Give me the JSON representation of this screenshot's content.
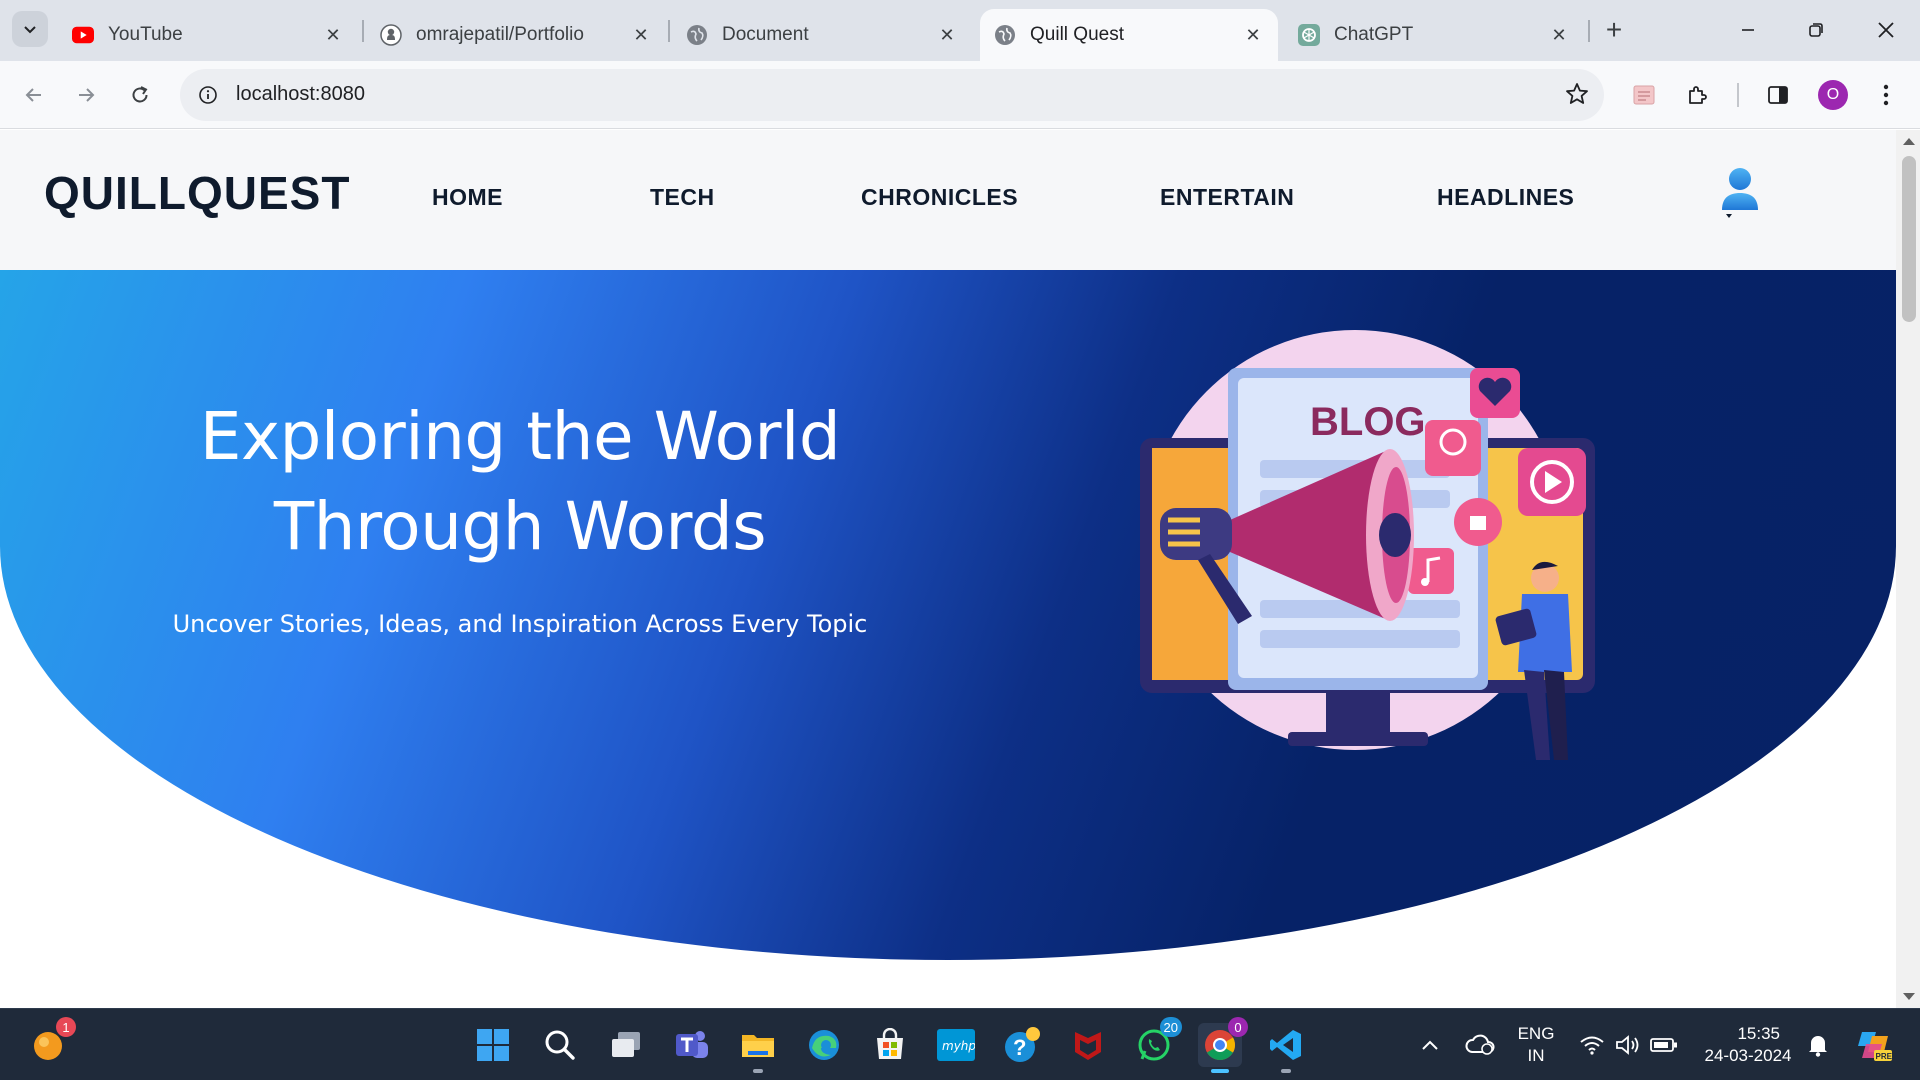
{
  "browser": {
    "tabs": [
      {
        "title": "YouTube",
        "icon": "youtube-icon"
      },
      {
        "title": "omrajepatil/Portfolio",
        "icon": "github-icon"
      },
      {
        "title": "Document",
        "icon": "globe-icon"
      },
      {
        "title": "Quill Quest",
        "icon": "globe-icon",
        "active": true
      },
      {
        "title": "ChatGPT",
        "icon": "chatgpt-icon"
      }
    ],
    "url": "localhost:8080",
    "profile_initial": "O"
  },
  "site": {
    "logo": "QUILLQUEST",
    "nav": [
      "HOME",
      "TECH",
      "CHRONICLES",
      "ENTERTAIN",
      "HEADLINES"
    ],
    "hero": {
      "title_line1": "Exploring the World",
      "title_line2": "Through Words",
      "subtitle": "Uncover Stories, Ideas, and Inspiration Across Every Topic",
      "art_label": "BLOG"
    }
  },
  "taskbar": {
    "notif_count": "1",
    "whatsapp_count": "20",
    "chrome_count": "0",
    "lang_line1": "ENG",
    "lang_line2": "IN",
    "time": "15:35",
    "date": "24-03-2024",
    "hp_label": "myhp",
    "copilot_label": "PRE"
  },
  "colors": {
    "accent": "#1a73e8",
    "hero_start": "#25a4e8",
    "hero_end": "#072266",
    "logo_text": "#0f1b2d",
    "taskbar_bg": "#1f2a3a"
  }
}
